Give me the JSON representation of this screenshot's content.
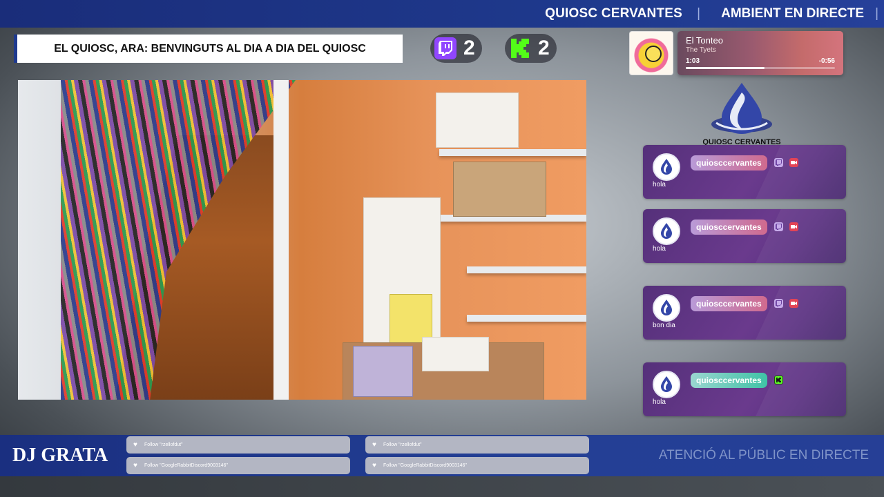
{
  "topbar": {
    "brand": "QUIOSC CERVANTES",
    "separator": "|",
    "tagline": "AMBIENT EN DIRECTE"
  },
  "title_banner": "EL QUIOSC, ARA: BENVINGUTS AL DIA A DIA DEL QUIOSC",
  "counters": {
    "twitch": {
      "icon": "twitch-icon",
      "value": "2",
      "color": "#9146ff"
    },
    "kick": {
      "icon": "kick-icon",
      "value": "2",
      "color": "#53fc18"
    }
  },
  "now_playing": {
    "title": "El Tonteo",
    "artist": "The Tyets",
    "elapsed": "1:03",
    "remaining": "-0:56",
    "progress": 0.53
  },
  "logo": {
    "text": "QUIOSC CERVANTES"
  },
  "chat": [
    {
      "user": "quiosccervantes",
      "message": "hola",
      "platform": "twitch",
      "badges": [
        "twitch-badge-icon",
        "camera-badge-icon"
      ]
    },
    {
      "user": "quiosccervantes",
      "message": "hola",
      "platform": "twitch",
      "badges": [
        "twitch-badge-icon",
        "camera-badge-icon"
      ]
    },
    {
      "user": "quiosccervantes",
      "message": "bon dia",
      "platform": "twitch",
      "badges": [
        "twitch-badge-icon",
        "camera-badge-icon"
      ]
    },
    {
      "user": "quiosccervantes",
      "message": "hola",
      "platform": "kick",
      "badges": [
        "kick-badge-icon"
      ]
    }
  ],
  "bottombar": {
    "dj": "DJ GRATA",
    "follows": [
      "Follow \"rzellofdut\"",
      "Follow \"GoogleRabbitDiscord9003146\"",
      "Follow \"rzellofdut\"",
      "Follow \"GoogleRabbitDiscord9003146\""
    ],
    "public_text": "ATENCIÓ AL PÚBLIC EN DIRECTE"
  }
}
